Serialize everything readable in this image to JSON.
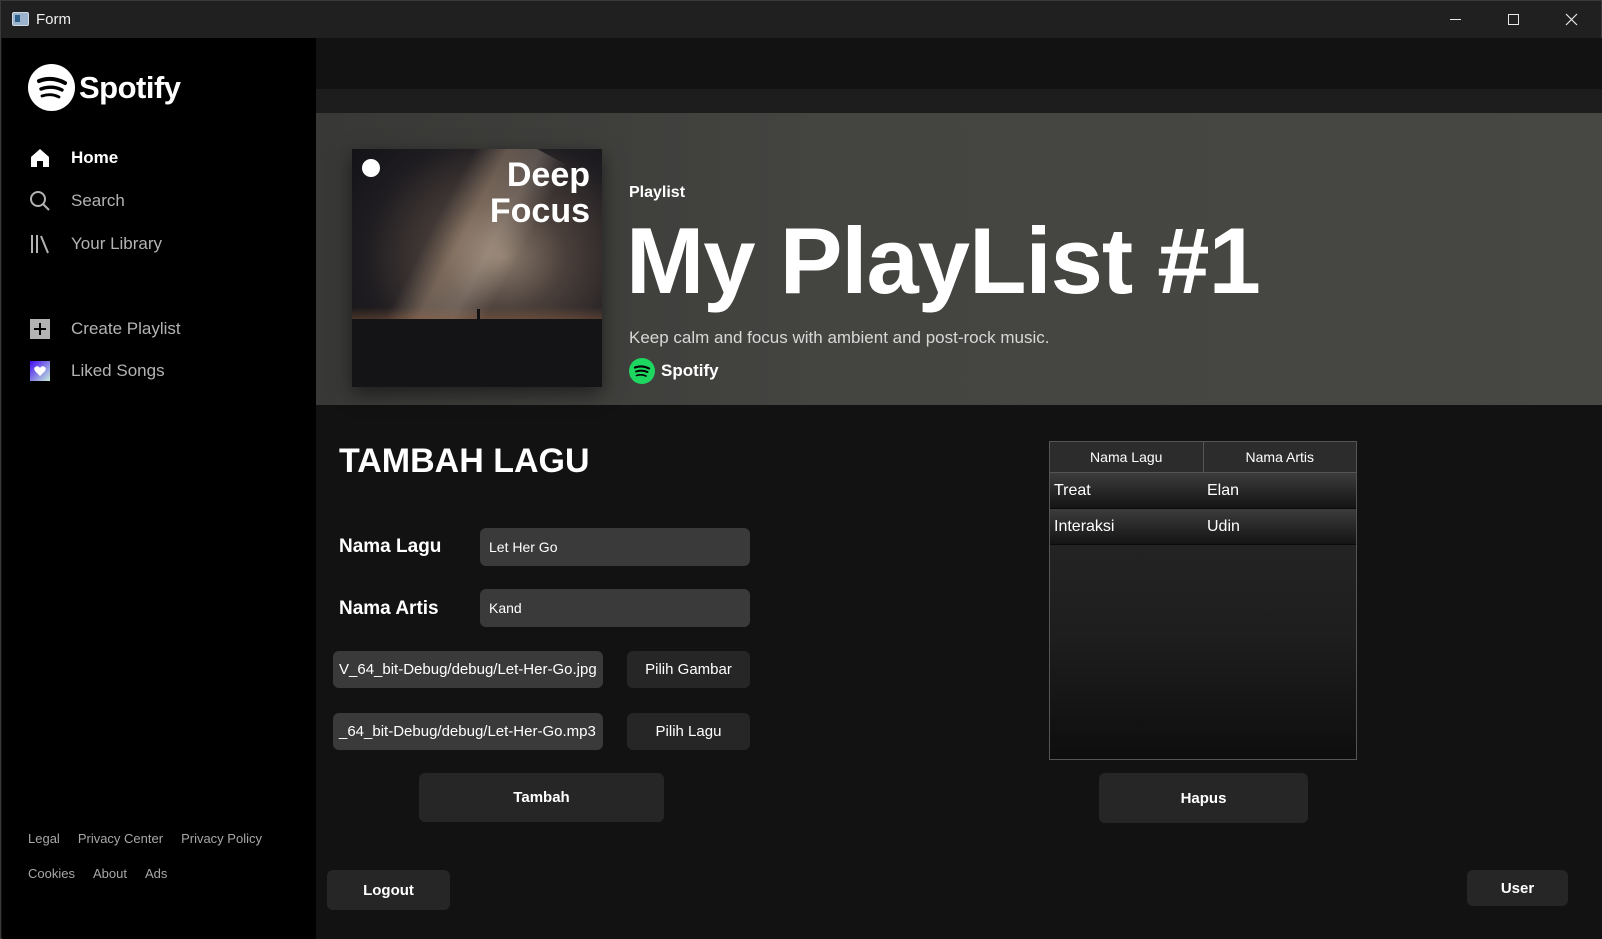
{
  "window": {
    "title": "Form"
  },
  "sidebar": {
    "logo_text": "Spotify",
    "nav": [
      {
        "label": "Home",
        "icon": "home-icon",
        "active": true
      },
      {
        "label": "Search",
        "icon": "search-icon"
      },
      {
        "label": "Your Library",
        "icon": "library-icon"
      },
      {
        "label": "Create Playlist",
        "icon": "plus-icon"
      },
      {
        "label": "Liked Songs",
        "icon": "heart-icon"
      }
    ],
    "footer_row1": [
      "Legal",
      "Privacy Center",
      "Privacy Policy"
    ],
    "footer_row2": [
      "Cookies",
      "About",
      "Ads"
    ]
  },
  "banner": {
    "cover_title_line1": "Deep",
    "cover_title_line2": "Focus",
    "type_label": "Playlist",
    "title": "My PlayList #1",
    "description": "Keep calm and focus with ambient and post-rock music.",
    "owner": "Spotify"
  },
  "form": {
    "heading": "TAMBAH LAGU",
    "song_label": "Nama Lagu",
    "song_value": "Let Her Go",
    "artist_label": "Nama Artis",
    "artist_value": "Kand",
    "image_path": "V_64_bit-Debug/debug/Let-Her-Go.jpg",
    "image_button": "Pilih Gambar",
    "audio_path": "_64_bit-Debug/debug/Let-Her-Go.mp3",
    "audio_button": "Pilih Lagu",
    "add_button": "Tambah"
  },
  "table": {
    "columns": [
      "Nama Lagu",
      "Nama Artis"
    ],
    "rows": [
      [
        "Treat",
        "Elan"
      ],
      [
        "Interaksi",
        "Udin"
      ]
    ],
    "delete_button": "Hapus"
  },
  "buttons": {
    "logout": "Logout",
    "user": "User"
  },
  "colors": {
    "accent": "#1ed760",
    "sidebar_bg": "#000000",
    "main_bg": "#121212",
    "banner_bg": "#444441"
  }
}
